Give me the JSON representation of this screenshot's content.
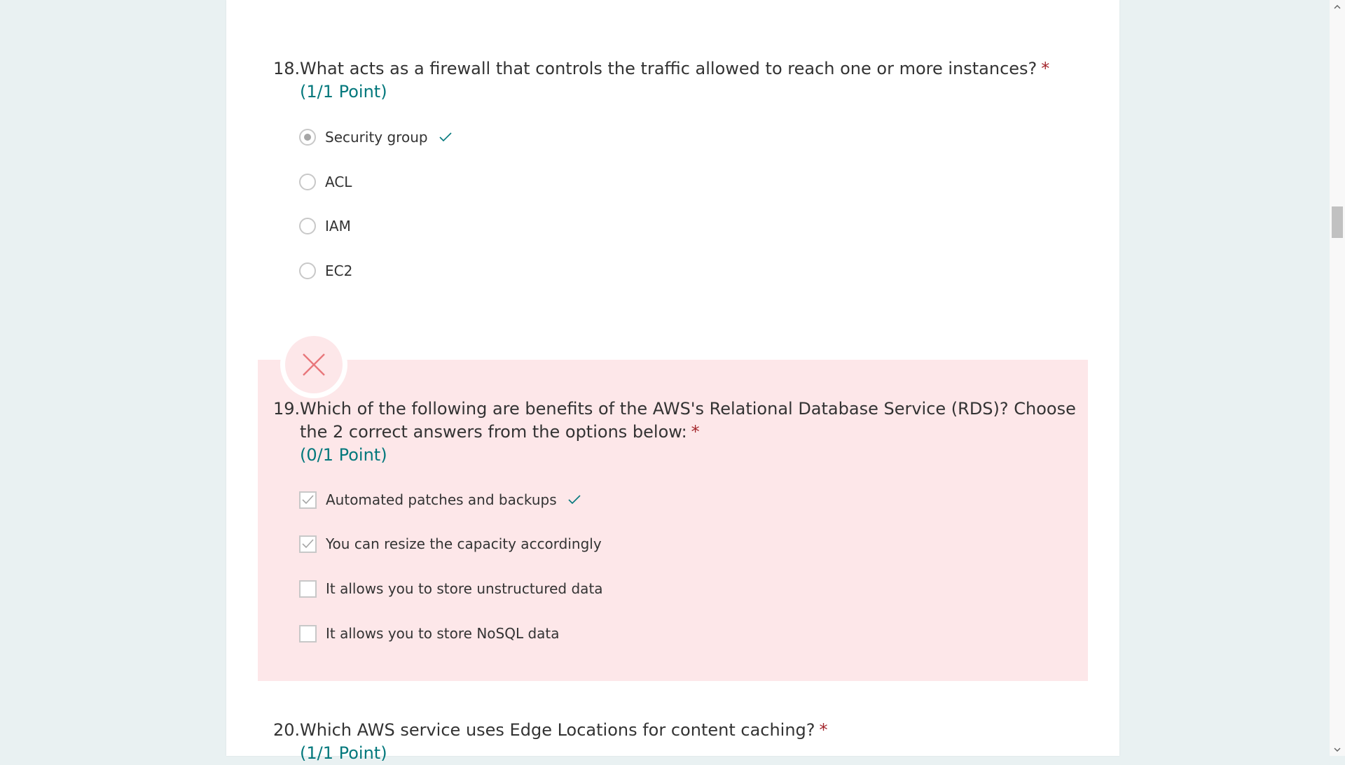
{
  "questions": [
    {
      "number": "18.",
      "text": "What acts as a firewall that controls the traffic allowed to reach one or more instances?",
      "required_marker": "*",
      "points": "(1/1 Point)",
      "type": "radio",
      "options": [
        {
          "label": "Security group",
          "selected": true,
          "correct": true
        },
        {
          "label": "ACL",
          "selected": false,
          "correct": false
        },
        {
          "label": "IAM",
          "selected": false,
          "correct": false
        },
        {
          "label": "EC2",
          "selected": false,
          "correct": false
        }
      ]
    },
    {
      "number": "19.",
      "text": "Which of the following are benefits of the AWS's Relational Database Service (RDS)? Choose the 2 correct answers from the options below:",
      "required_marker": "*",
      "points": "(0/1 Point)",
      "type": "checkbox",
      "status": "incorrect",
      "options": [
        {
          "label": "Automated patches and backups",
          "selected": true,
          "correct": true
        },
        {
          "label": "You can resize the capacity accordingly",
          "selected": true,
          "correct": false
        },
        {
          "label": "It allows you to store unstructured data",
          "selected": false,
          "correct": false
        },
        {
          "label": "It allows you to store NoSQL data",
          "selected": false,
          "correct": false
        }
      ]
    },
    {
      "number": "20.",
      "text": "Which AWS service uses Edge Locations for content caching?",
      "required_marker": "*",
      "points": "(1/1 Point)"
    }
  ],
  "colors": {
    "background": "#e9f1f2",
    "accent": "#03787c",
    "required": "#a4262c",
    "incorrect_band": "#fde7e9",
    "incorrect_icon": "#e8777b"
  },
  "icons": {
    "correct": "checkmark-icon",
    "incorrect": "close-x-icon"
  }
}
